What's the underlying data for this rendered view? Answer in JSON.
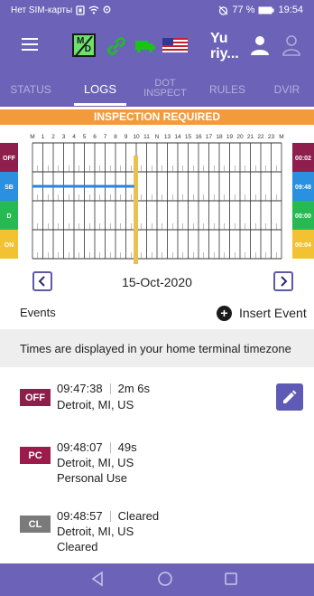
{
  "status_bar": {
    "carrier": "Нет SIM-карты",
    "battery": "77 %",
    "time": "19:54"
  },
  "header": {
    "md_icon": {
      "m": "M",
      "d": "D"
    },
    "user_name_line1": "Yu",
    "user_name_line2": "riy...",
    "icons": [
      "menu-icon",
      "md-status-icon",
      "link-icon",
      "truck-icon",
      "us-flag-icon",
      "driver-icon",
      "co-driver-icon"
    ],
    "colors": {
      "bar": "#6c63b8",
      "green": "#18c418"
    }
  },
  "tabs": [
    {
      "label": "STATUS"
    },
    {
      "label": "LOGS"
    },
    {
      "label_line1": "DOT",
      "label_line2": "INSPECT"
    },
    {
      "label": "RULES"
    },
    {
      "label": "DVIR"
    }
  ],
  "active_tab": "LOGS",
  "banner": {
    "text": "INSPECTION REQUIRED",
    "color": "#f39a3d"
  },
  "graph": {
    "hour_labels": [
      "M",
      "1",
      "2",
      "3",
      "4",
      "5",
      "6",
      "7",
      "8",
      "9",
      "10",
      "11",
      "N",
      "13",
      "14",
      "15",
      "16",
      "17",
      "18",
      "19",
      "20",
      "21",
      "22",
      "23",
      "M"
    ],
    "rows": [
      {
        "label": "OFF",
        "total": "00:02",
        "color": "#8e1e4b"
      },
      {
        "label": "SB",
        "total": "09:48",
        "color": "#2a90df"
      },
      {
        "label": "D",
        "total": "00:00",
        "color": "#26bb52"
      },
      {
        "label": "ON",
        "total": "00:04",
        "color": "#f2c232"
      }
    ],
    "segments": [
      {
        "status": "SB",
        "start_hour": 0,
        "end_hour": 9.8
      }
    ],
    "current_hour": 9.96,
    "line_color": "#2a83d8",
    "marker_color": "#e9c14e"
  },
  "date_nav": {
    "date": "15-Oct-2020",
    "prev_symbol": "‹",
    "next_symbol": "›"
  },
  "events_header": {
    "label": "Events",
    "insert_label": "Insert Event",
    "insert_symbol": "+"
  },
  "timezone_note": "Times are displayed in your home terminal timezone",
  "events": [
    {
      "badge": "OFF",
      "badge_color": "#8e1e4b",
      "time": "09:47:38",
      "duration": "2m 6s",
      "location": "Detroit, MI, US",
      "note": ""
    },
    {
      "badge": "PC",
      "badge_color": "#9b1c4a",
      "time": "09:48:07",
      "duration": "49s",
      "location": "Detroit, MI, US",
      "note": "Personal Use"
    },
    {
      "badge": "CL",
      "badge_color": "#7a7a7a",
      "time": "09:48:57",
      "duration": "Cleared",
      "location": "Detroit, MI, US",
      "note": "Cleared"
    }
  ],
  "bottom_nav": [
    "back-nav-icon",
    "home-nav-icon",
    "recents-nav-icon"
  ]
}
